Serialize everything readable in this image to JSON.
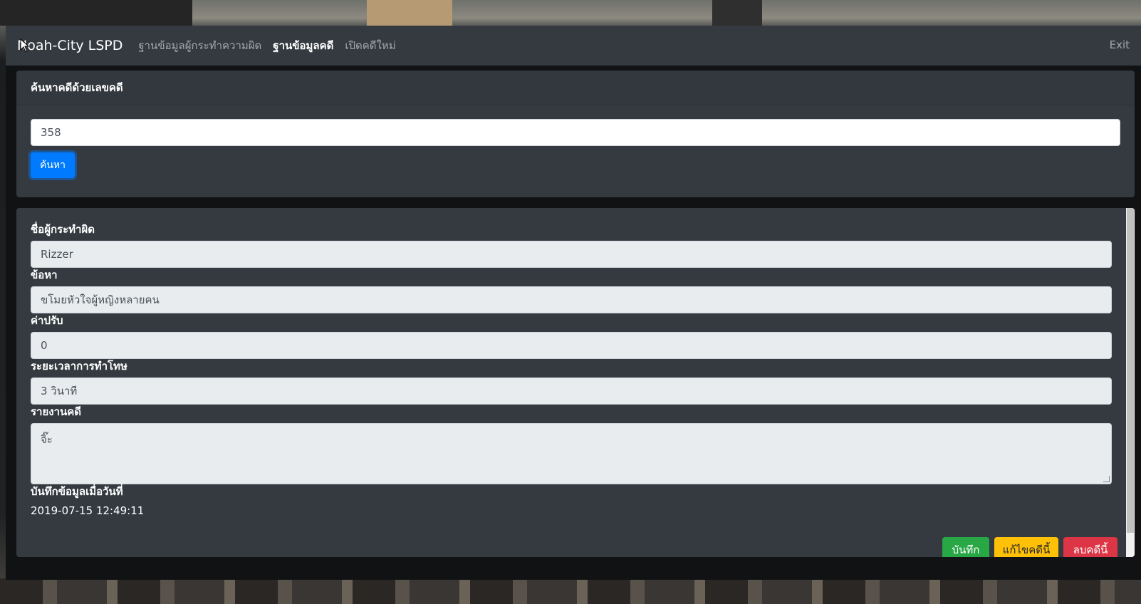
{
  "navbar": {
    "brand": "Noah-City LSPD",
    "links": [
      "ฐานข้อมูลผู้กระทำความผิด",
      "ฐานข้อมูลคดี",
      "เปิดคดีใหม่"
    ],
    "exit": "Exit"
  },
  "search": {
    "header": "ค้นหาคดีด้วยเลขคดี",
    "value": "358",
    "button": "ค้นหา"
  },
  "detail": {
    "fields": [
      {
        "label": "ชื่อผู้กระทำผิด",
        "value": "Rizzer"
      },
      {
        "label": "ข้อหา",
        "value": "ขโมยหัวใจผู้หญิงหลายคน"
      },
      {
        "label": "ค่าปรับ",
        "value": "0"
      },
      {
        "label": "ระยะเวลาการทำโทษ",
        "value": "3 วินาที"
      },
      {
        "label": "รายงานคดี",
        "value": "จิ๊ะ"
      }
    ],
    "recorded_label": "บันทึกข้อมูลเมื่อวันที่",
    "recorded_value": "2019-07-15 12:49:11",
    "buttons": {
      "save": "บันทึก",
      "edit": "แก้ไขคดีนี้",
      "delete": "ลบคดีนี้"
    }
  }
}
